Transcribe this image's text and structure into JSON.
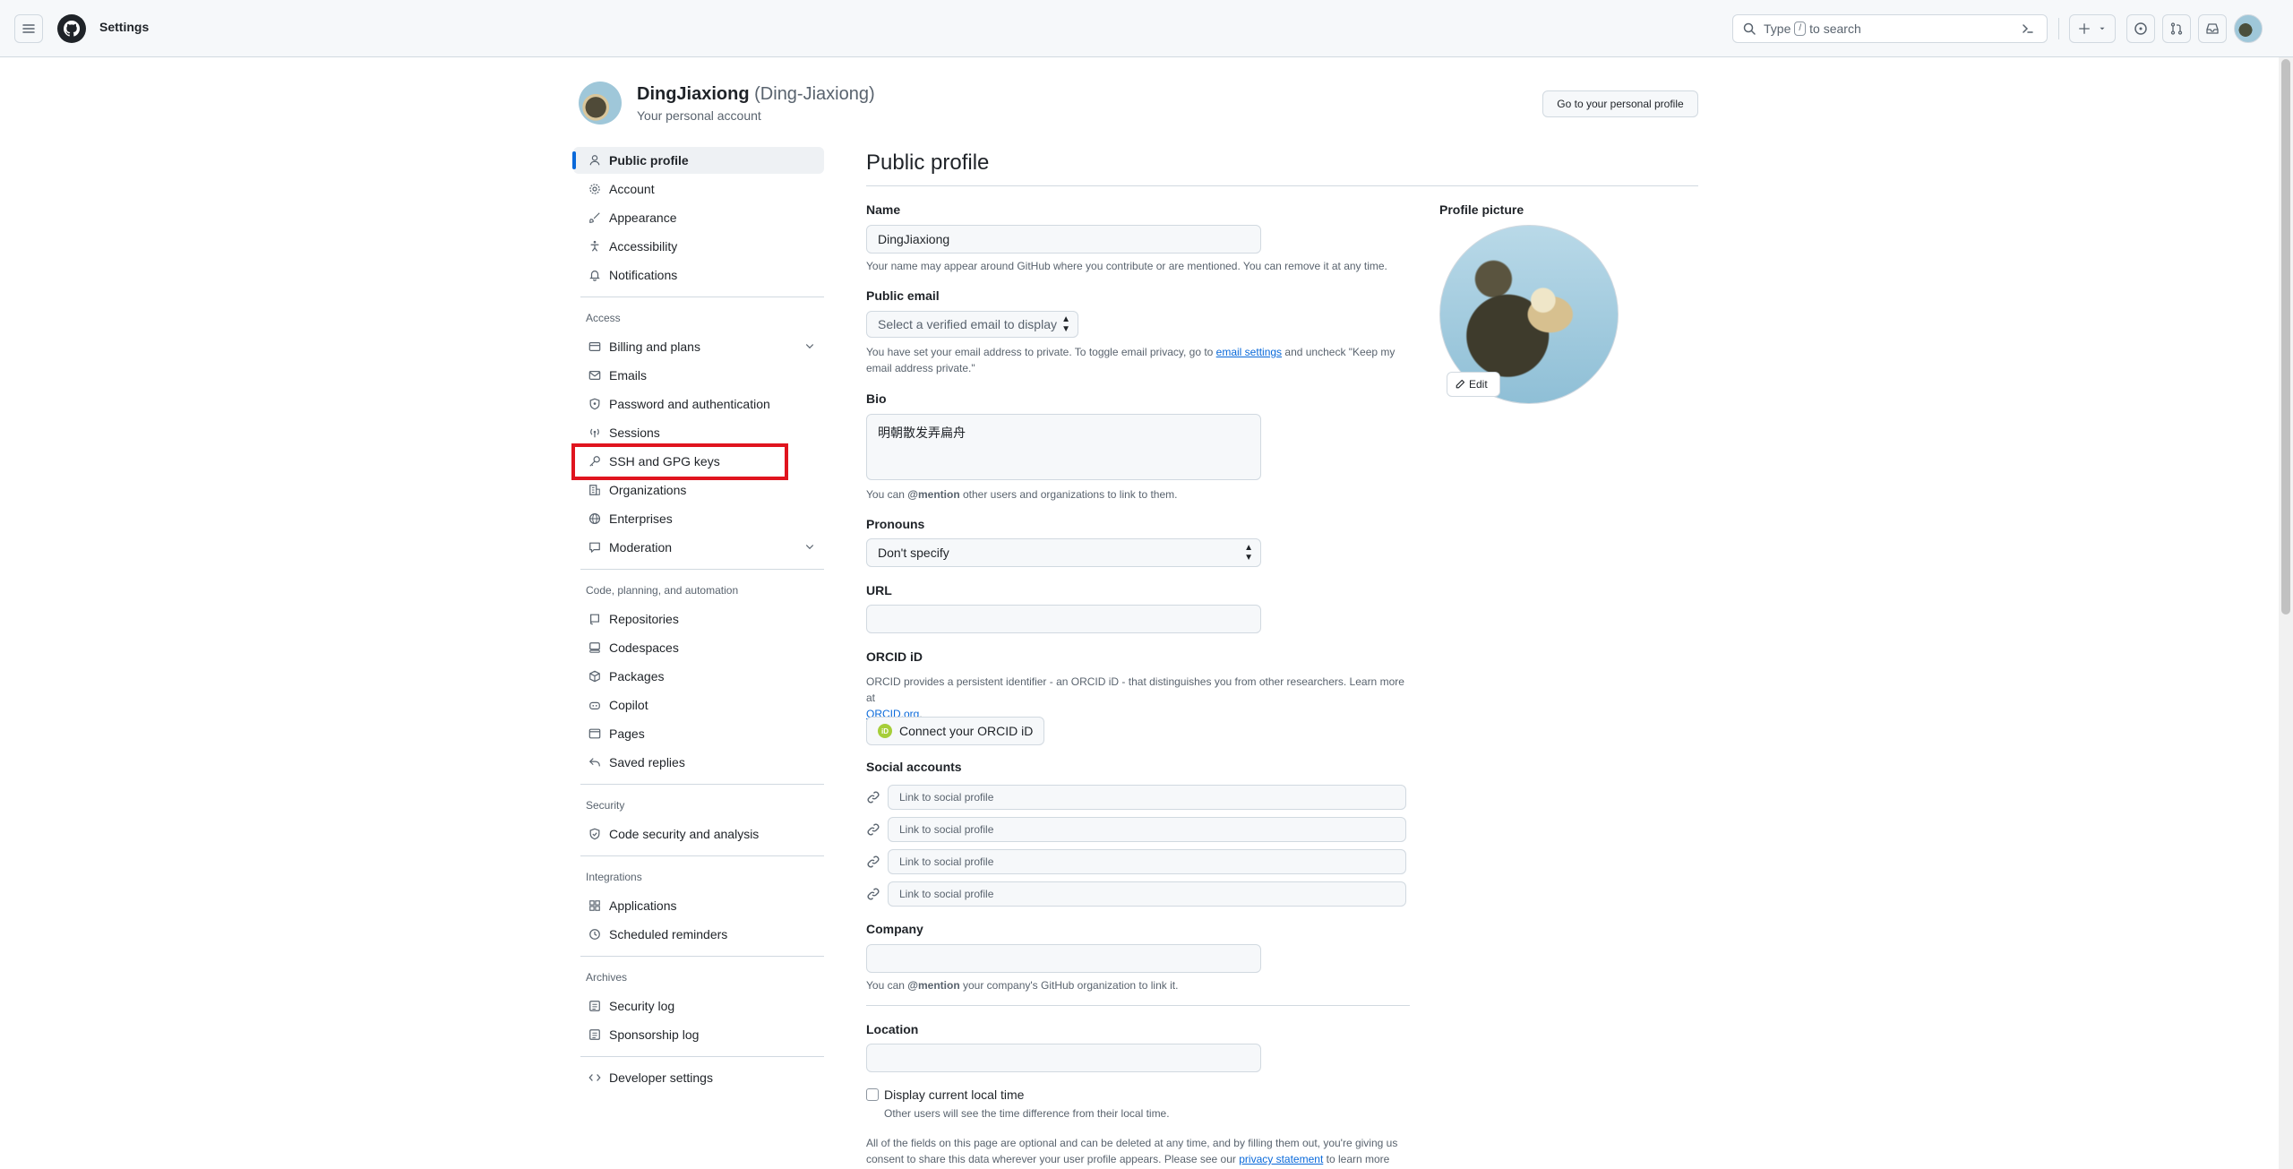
{
  "header": {
    "title": "Settings",
    "search_prefix": "Type",
    "search_key": "/",
    "search_suffix": "to search",
    "icons": [
      "menu-icon",
      "github-logo-icon",
      "search-icon",
      "command-palette-icon",
      "plus-icon",
      "issues-icon",
      "pull-requests-icon",
      "inbox-icon"
    ]
  },
  "user": {
    "display_name": "DingJiaxiong",
    "login": "(Ding-Jiaxiong)",
    "subtitle": "Your personal account",
    "go_profile_label": "Go to your personal profile"
  },
  "sidebar": {
    "items_top": [
      {
        "label": "Public profile",
        "icon": "person-icon"
      },
      {
        "label": "Account",
        "icon": "gear-icon"
      },
      {
        "label": "Appearance",
        "icon": "paintbrush-icon"
      },
      {
        "label": "Accessibility",
        "icon": "accessibility-icon"
      },
      {
        "label": "Notifications",
        "icon": "bell-icon"
      }
    ],
    "headings": {
      "access": "Access",
      "code": "Code, planning, and automation",
      "security": "Security",
      "integrations": "Integrations",
      "archives": "Archives"
    },
    "access": [
      {
        "label": "Billing and plans",
        "icon": "credit-card-icon"
      },
      {
        "label": "Emails",
        "icon": "mail-icon"
      },
      {
        "label": "Password and authentication",
        "icon": "shield-lock-icon"
      },
      {
        "label": "Sessions",
        "icon": "broadcast-icon"
      },
      {
        "label": "SSH and GPG keys",
        "icon": "key-icon"
      },
      {
        "label": "Organizations",
        "icon": "organization-icon"
      },
      {
        "label": "Enterprises",
        "icon": "globe-icon"
      },
      {
        "label": "Moderation",
        "icon": "report-icon"
      }
    ],
    "code": [
      {
        "label": "Repositories",
        "icon": "repo-icon"
      },
      {
        "label": "Codespaces",
        "icon": "codespaces-icon"
      },
      {
        "label": "Packages",
        "icon": "package-icon"
      },
      {
        "label": "Copilot",
        "icon": "copilot-icon"
      },
      {
        "label": "Pages",
        "icon": "browser-icon"
      },
      {
        "label": "Saved replies",
        "icon": "reply-icon"
      }
    ],
    "security": [
      {
        "label": "Code security and analysis",
        "icon": "shield-check-icon"
      }
    ],
    "integrations": [
      {
        "label": "Applications",
        "icon": "apps-icon"
      },
      {
        "label": "Scheduled reminders",
        "icon": "clock-icon"
      }
    ],
    "archives": [
      {
        "label": "Security log",
        "icon": "log-icon"
      },
      {
        "label": "Sponsorship log",
        "icon": "log-icon"
      }
    ],
    "developer": {
      "label": "Developer settings",
      "icon": "code-icon"
    }
  },
  "main": {
    "title": "Public profile",
    "name_label": "Name",
    "name_value": "DingJiaxiong",
    "name_hint": "Your name may appear around GitHub where you contribute or are mentioned. You can remove it at any time.",
    "email_label": "Public email",
    "email_select": "Select a verified email to display",
    "email_hint_1": "You have set your email address to private. To toggle email privacy, go to",
    "email_hint_link": "email settings",
    "email_hint_2": "and uncheck \"Keep my",
    "email_hint_3": "email address private.\"",
    "bio_label": "Bio",
    "bio_value": "明朝散发弄扁舟",
    "bio_hint_1": "You can",
    "bio_hint_mention": "@mention",
    "bio_hint_2": "other users and organizations to link to them.",
    "pronouns_label": "Pronouns",
    "pronouns_value": "Don't specify",
    "url_label": "URL",
    "url_value": "",
    "orcid_label": "ORCID iD",
    "orcid_hint_1": "ORCID provides a persistent identifier - an ORCID iD - that distinguishes you from other researchers. Learn more at",
    "orcid_hint_link": "ORCID.org",
    "orcid_hint_end": ".",
    "orcid_button": "Connect your ORCID iD",
    "orcid_badge": "iD",
    "social_label": "Social accounts",
    "social_placeholders": [
      "Link to social profile",
      "Link to social profile",
      "Link to social profile",
      "Link to social profile"
    ],
    "company_label": "Company",
    "company_value": "",
    "company_hint_1": "You can",
    "company_hint_mention": "@mention",
    "company_hint_2": "your company's GitHub organization to link it.",
    "location_label": "Location",
    "location_value": "",
    "localtime_label": "Display current local time",
    "localtime_hint": "Other users will see the time difference from their local time.",
    "footer_1": "All of the fields on this page are optional and can be deleted at any time, and by filling them out, you're giving us",
    "footer_2": "consent to share this data wherever your user profile appears. Please see our",
    "footer_link": "privacy statement",
    "footer_3": "to learn more"
  },
  "profile_picture": {
    "label": "Profile picture",
    "edit_label": "Edit"
  },
  "colors": {
    "accent": "#0969da",
    "highlight": "#e0141e"
  }
}
